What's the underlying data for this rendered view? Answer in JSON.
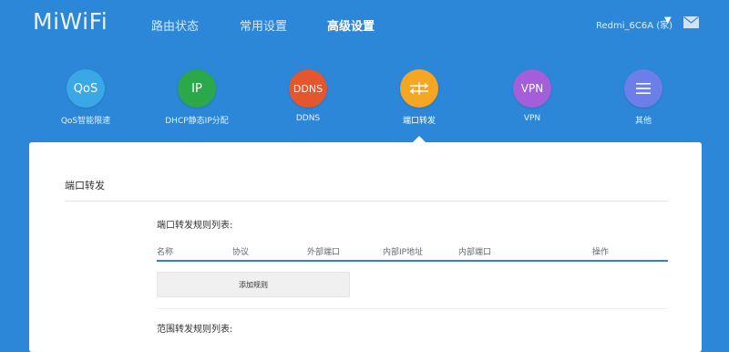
{
  "header": {
    "logo": "MiWiFi",
    "tabs": [
      {
        "label": "路由状态",
        "active": false
      },
      {
        "label": "常用设置",
        "active": false
      },
      {
        "label": "高级设置",
        "active": true
      }
    ],
    "device_name": "Redmi_6C6A (家)",
    "icons": {
      "dropdown": "chevron-down-icon",
      "mail": "mail-icon"
    }
  },
  "features": [
    {
      "label": "QoS智能限速",
      "icon_text": "QoS",
      "color": "#3aa7e6"
    },
    {
      "label": "DHCP静态IP分配",
      "icon_text": "IP",
      "color": "#2aa84a"
    },
    {
      "label": "DDNS",
      "icon_text": "DDNS",
      "color": "#e4572e"
    },
    {
      "label": "端口转发",
      "icon_text": "",
      "color": "#f5a623",
      "active": true
    },
    {
      "label": "VPN",
      "icon_text": "VPN",
      "color": "#a45ed9"
    },
    {
      "label": "其他",
      "icon_text": "",
      "color": "#6c7fe8"
    }
  ],
  "panel": {
    "title": "端口转发",
    "port_list_title": "端口转发规则列表:",
    "columns": [
      "名称",
      "协议",
      "外部端口",
      "内部IP地址",
      "内部端口",
      "操作"
    ],
    "add_button": "添加规则",
    "range_list_title": "范围转发规则列表:"
  }
}
